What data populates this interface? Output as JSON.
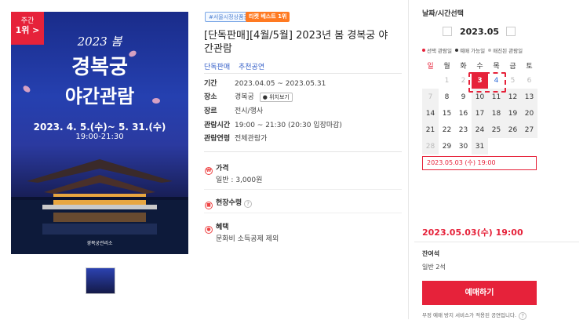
{
  "poster": {
    "rank_top": "주간",
    "rank_bottom": "1위 >",
    "title_year": "2023 봄",
    "title_main1": "경복궁",
    "title_main2": "야간관람",
    "date_range": "2023. 4. 5.(수)~ 5. 31.(수)",
    "time_range": "19:00-21:30",
    "org": "경복궁관리소"
  },
  "tags": {
    "tag1": "#서울시정상품관",
    "tag2": "티켓 베스트 1위"
  },
  "title": "[단독판매][4월/5월] 2023년 봄 경복궁 야간관람",
  "sale": {
    "label": "단독판매",
    "value": "추천공연"
  },
  "info": {
    "period_k": "기간",
    "period_v": "2023.04.05 ~ 2023.05.31",
    "place_k": "장소",
    "place_v": "경복궁",
    "map_btn": "위치보기",
    "genre_k": "장르",
    "genre_v": "전시/행사",
    "time_k": "관람시간",
    "time_v": "19:00 ~ 21:30 (20:30 입장마감)",
    "age_k": "관람연령",
    "age_v": "전체관람가"
  },
  "price": {
    "heading": "가격",
    "value": "일반 : 3,000원"
  },
  "onsite": {
    "heading": "현장수령"
  },
  "benefit": {
    "heading": "혜택",
    "value": "문화비 소득공제 제외"
  },
  "booking": {
    "label": "날짜/시간선택",
    "month": "2023.05",
    "legend_selected": "선택 관람일",
    "legend_available": "예매 가능일",
    "legend_soldout": "매진된 관람일",
    "weekdays": [
      "일",
      "월",
      "화",
      "수",
      "목",
      "금",
      "토"
    ],
    "weeks": [
      [
        "",
        "1",
        "2",
        "3",
        "4",
        "5",
        "6"
      ],
      [
        "7",
        "8",
        "9",
        "10",
        "11",
        "12",
        "13"
      ],
      [
        "14",
        "15",
        "16",
        "17",
        "18",
        "19",
        "20"
      ],
      [
        "21",
        "22",
        "23",
        "24",
        "25",
        "26",
        "27"
      ],
      [
        "28",
        "29",
        "30",
        "31",
        "",
        "",
        ""
      ]
    ],
    "time_option": "2023.05.03 (수) 19:00",
    "selected_datetime": "2023.05.03(수) 19:00",
    "seat_label": "잔여석",
    "seat_value": "일반 2석",
    "book_button": "예매하기",
    "notice": "부정 예매 방지 서비스가 적용된 공연입니다."
  },
  "colors": {
    "accent": "#e6223a",
    "link": "#3a63c9",
    "orange": "#ff7a22"
  }
}
